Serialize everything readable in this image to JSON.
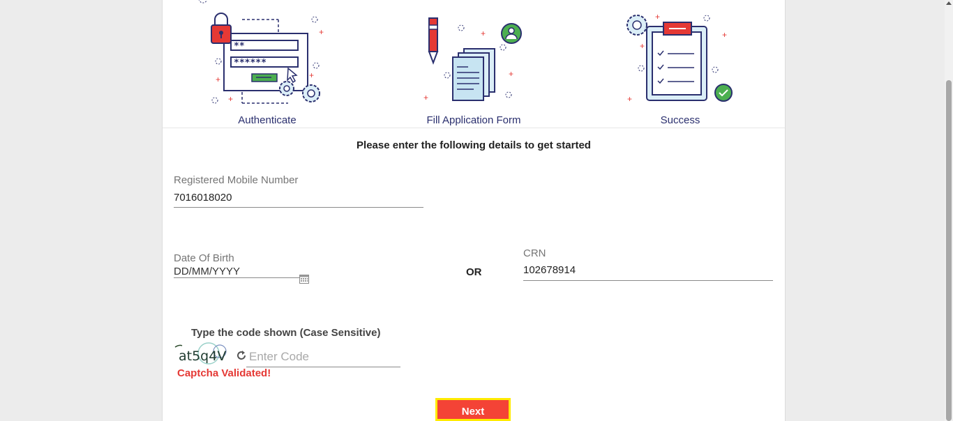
{
  "steps": [
    {
      "label": "Authenticate",
      "icon": "login-lock-icon"
    },
    {
      "label": "Fill Application Form",
      "icon": "form-documents-icon"
    },
    {
      "label": "Success",
      "icon": "checklist-success-icon"
    }
  ],
  "form": {
    "intro": "Please enter the following details to get started",
    "mobile": {
      "label": "Registered Mobile Number",
      "value": "7016018020"
    },
    "dob": {
      "label": "Date Of Birth",
      "placeholder": "DD/MM/YYYY"
    },
    "or_label": "OR",
    "crn": {
      "label": "CRN",
      "value": "102678914"
    },
    "captcha": {
      "title": "Type the code shown (Case Sensitive)",
      "image_text": "at5q4V",
      "input_placeholder": "Enter Code",
      "status": "Captcha Validated!"
    },
    "next_label": "Next"
  },
  "colors": {
    "accent": "#f44336",
    "highlight": "#ffeb00",
    "label_blue": "#2a2f6e",
    "error_red": "#e53935"
  }
}
